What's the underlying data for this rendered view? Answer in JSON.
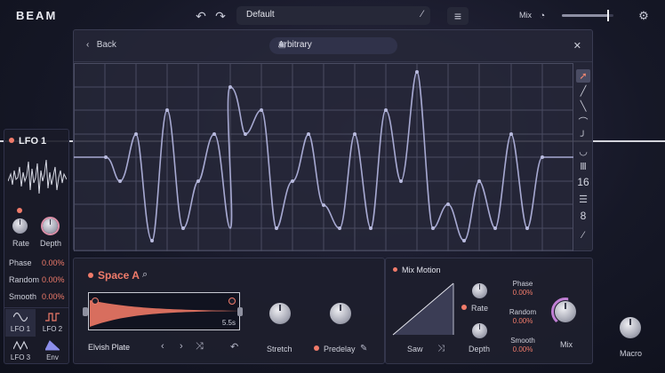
{
  "app": {
    "logo": "BEAM"
  },
  "topbar": {
    "undo_icon": "undo-icon",
    "redo_icon": "redo-icon",
    "preset_name": "Default",
    "mix_label": "Mix",
    "mix_value": 0.9
  },
  "lfo_editor": {
    "back_label": "Back",
    "shape_name": "Arbitrary",
    "grid_x": "16",
    "grid_y": "8"
  },
  "lfo_panel": {
    "title": "LFO 1",
    "rate_label": "Rate",
    "depth_label": "Depth",
    "params": [
      {
        "label": "Phase",
        "value": "0.00%"
      },
      {
        "label": "Random",
        "value": "0.00%"
      },
      {
        "label": "Smooth",
        "value": "0.00%"
      }
    ],
    "tabs": [
      {
        "label": "LFO 1"
      },
      {
        "label": "LFO 2"
      },
      {
        "label": "LFO 3"
      },
      {
        "label": "Env"
      }
    ]
  },
  "fx": {
    "title": "Space A",
    "decay_time": "5.5s",
    "algorithm": "Elvish Plate",
    "stretch_label": "Stretch",
    "predelay_label": "Predelay"
  },
  "mix_motion": {
    "title": "Mix Motion",
    "wave_label": "Saw",
    "rate_label": "Rate",
    "depth_label": "Depth",
    "params": [
      {
        "label": "Phase",
        "value": "0.00%"
      },
      {
        "label": "Random",
        "value": "0.00%"
      },
      {
        "label": "Smooth",
        "value": "0.00%"
      }
    ],
    "mix_label": "Mix"
  },
  "macro": {
    "label": "Macro"
  },
  "colors": {
    "accent": "#f07b6a",
    "background": "#161827",
    "panel": "#1e1f2e"
  }
}
